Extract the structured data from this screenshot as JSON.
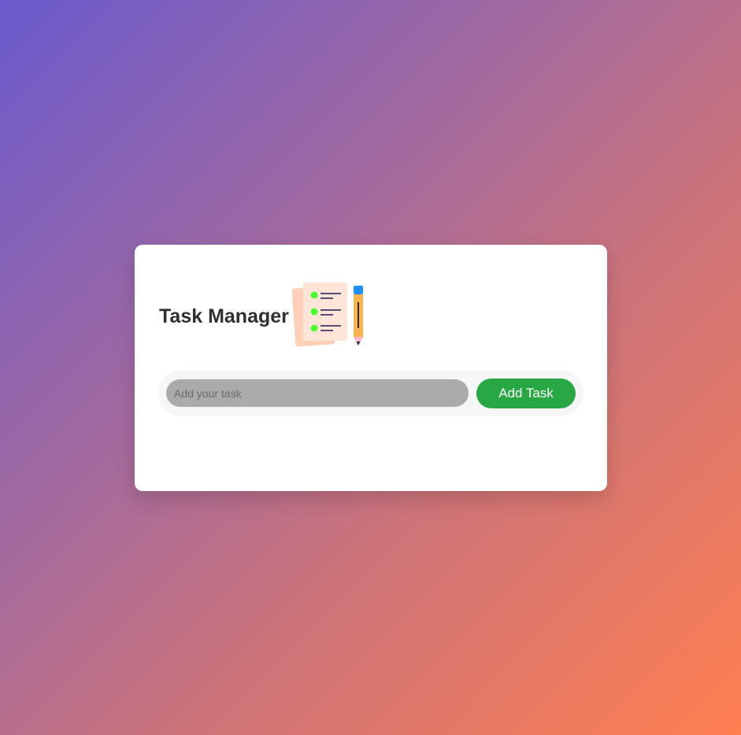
{
  "app": {
    "title": "Task Manager",
    "illustration_icon": "checklist-with-pencil-icon"
  },
  "task_form": {
    "input_value": "",
    "input_placeholder": "Add your task",
    "add_button_label": "Add Task"
  },
  "colors": {
    "background_gradient_start": "#6a5acd",
    "background_gradient_end": "#ff7f50",
    "add_button": "#28a745",
    "input_background": "#aaaaaa",
    "checklist_bullet": "#4cff2e",
    "pencil_body": "#f9b54c",
    "pencil_eraser": "#1e90ff"
  }
}
